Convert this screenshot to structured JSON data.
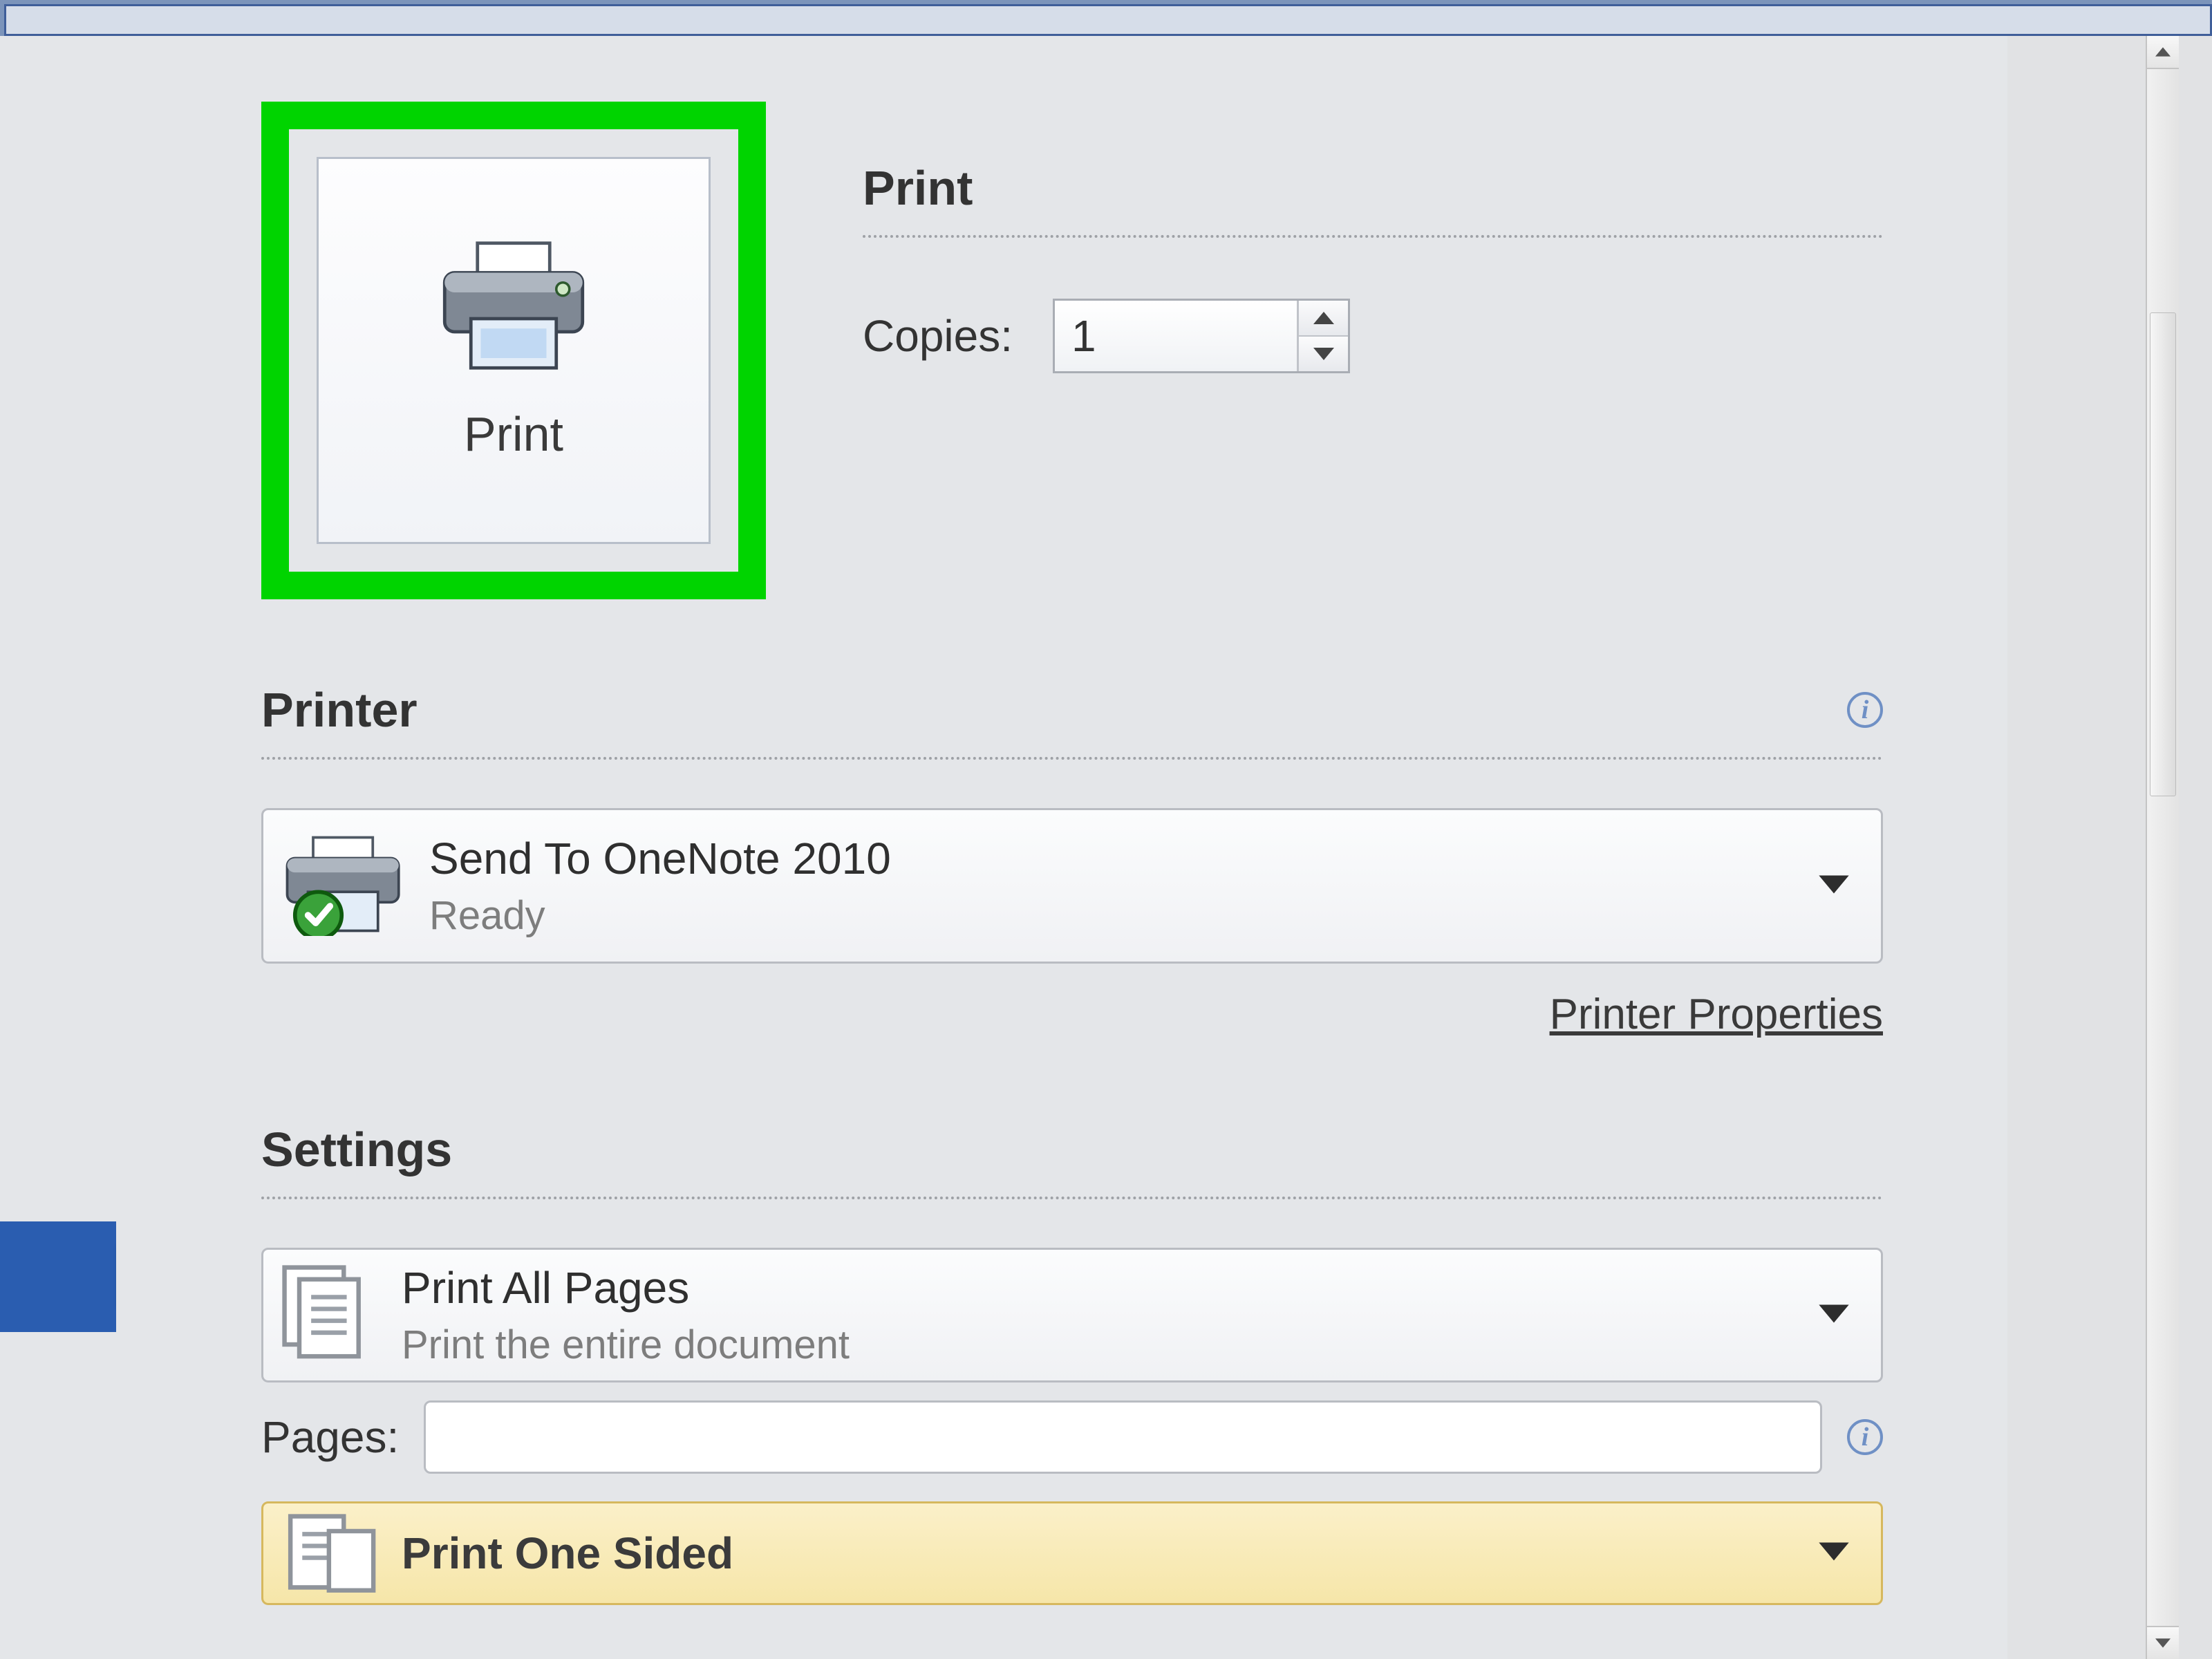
{
  "print_button_label": "Print",
  "print_heading": "Print",
  "copies": {
    "label": "Copies:",
    "value": "1"
  },
  "printer_section": {
    "title": "Printer",
    "selected": {
      "name": "Send To OneNote 2010",
      "status": "Ready"
    },
    "properties_link": "Printer Properties"
  },
  "settings_section": {
    "title": "Settings",
    "range": {
      "title": "Print All Pages",
      "subtitle": "Print the entire document"
    },
    "pages": {
      "label": "Pages:",
      "value": ""
    },
    "sided": {
      "title": "Print One Sided"
    }
  }
}
